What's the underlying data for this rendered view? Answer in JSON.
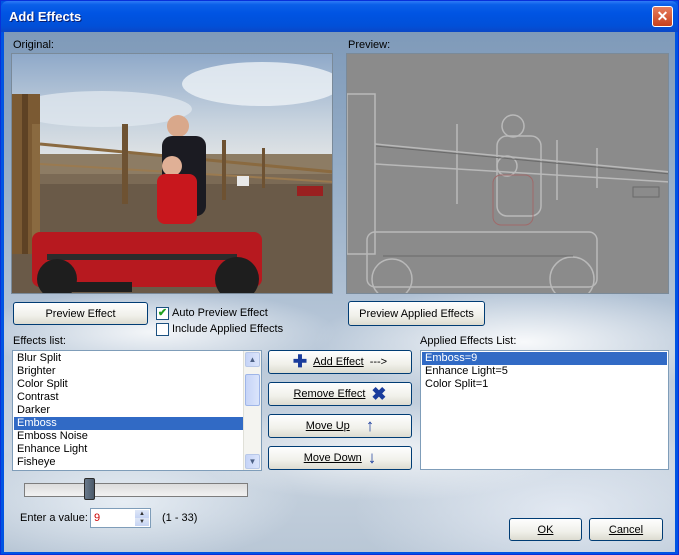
{
  "window": {
    "title": "Add Effects",
    "close_glyph": "✕"
  },
  "original": {
    "label": "Original:"
  },
  "preview": {
    "label": "Preview:"
  },
  "buttons": {
    "preview_effect": "Preview Effect",
    "preview_applied": "Preview Applied Effects",
    "add_effect": "Add Effect",
    "add_arrow": "--->",
    "remove_effect": "Remove Effect",
    "move_up": "Move Up",
    "move_down": "Move Down",
    "ok": "OK",
    "cancel": "Cancel"
  },
  "options": {
    "auto_preview": {
      "label": "Auto Preview Effect",
      "checked": true
    },
    "include_applied": {
      "label": "Include Applied Effects",
      "checked": false
    }
  },
  "effects_list": {
    "label": "Effects list:",
    "items": [
      "Blur Split",
      "Brighter",
      "Color Split",
      "Contrast",
      "Darker",
      "Emboss",
      "Emboss Noise",
      "Enhance Light",
      "Fisheye"
    ],
    "selected": "Emboss"
  },
  "applied_list": {
    "label": "Applied Effects List:",
    "items": [
      "Emboss=9",
      "Enhance Light=5",
      "Color Split=1"
    ],
    "selected": "Emboss=9"
  },
  "value": {
    "label": "Enter a value:",
    "current": "9",
    "range": "(1 - 33)",
    "slider_fraction": 0.25
  },
  "icons": {
    "add": "plus-icon",
    "remove": "x-icon",
    "up": "arrow-up-icon",
    "down": "arrow-down-icon",
    "check": "✔"
  }
}
